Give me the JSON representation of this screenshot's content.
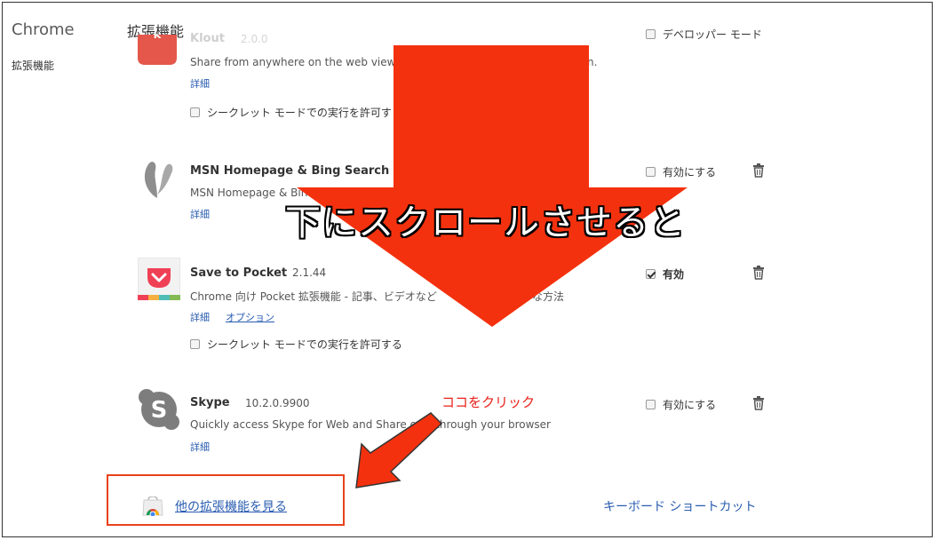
{
  "sidebar": {
    "title": "Chrome",
    "items": [
      {
        "label": "拡張機能"
      }
    ]
  },
  "header": {
    "title": "拡張機能",
    "developer_mode_label": "デベロッパー モード"
  },
  "extensions": [
    {
      "name": "Klout",
      "version": "2.0.0",
      "description": "Share from anywhere on the web view K",
      "description_tail": "n.",
      "details_label": "詳細",
      "incognito_label": "シークレット モードでの実行を許可す"
    },
    {
      "name": "MSN Homepage & Bing Search Engi",
      "description": "MSN Homepage & Bin",
      "details_label": "詳細",
      "enable_label": "有効にする",
      "enabled": false
    },
    {
      "name": "Save to Pocket",
      "version": "2.1.44",
      "description": "Chrome 向け Pocket 拡張機能 - 記事、ビデオなど",
      "description_tail": "な方法",
      "details_label": "詳細",
      "options_label": "オプション",
      "enable_label": "有効",
      "enabled": true,
      "incognito_label": "シークレット モードでの実行を許可する"
    },
    {
      "name": "Skype",
      "version": "10.2.0.9900",
      "description": "Quickly access Skype for Web and Share o",
      "description_tail": "e through your browser",
      "details_label": "詳細",
      "enable_label": "有効にする",
      "enabled": false
    }
  ],
  "footer": {
    "more_extensions_label": "他の拡張機能を見る",
    "keyboard_shortcuts_label": "キーボード ショートカット"
  },
  "annotations": {
    "scroll_caption": "下にスクロールさせると",
    "click_caption": "ココをクリック",
    "arrow_color": "#f4310e"
  },
  "colors": {
    "link": "#2a5db0",
    "highlight": "#e8411b",
    "pocket_red": "#ef4056",
    "skype_gray": "#7d7d7d"
  }
}
